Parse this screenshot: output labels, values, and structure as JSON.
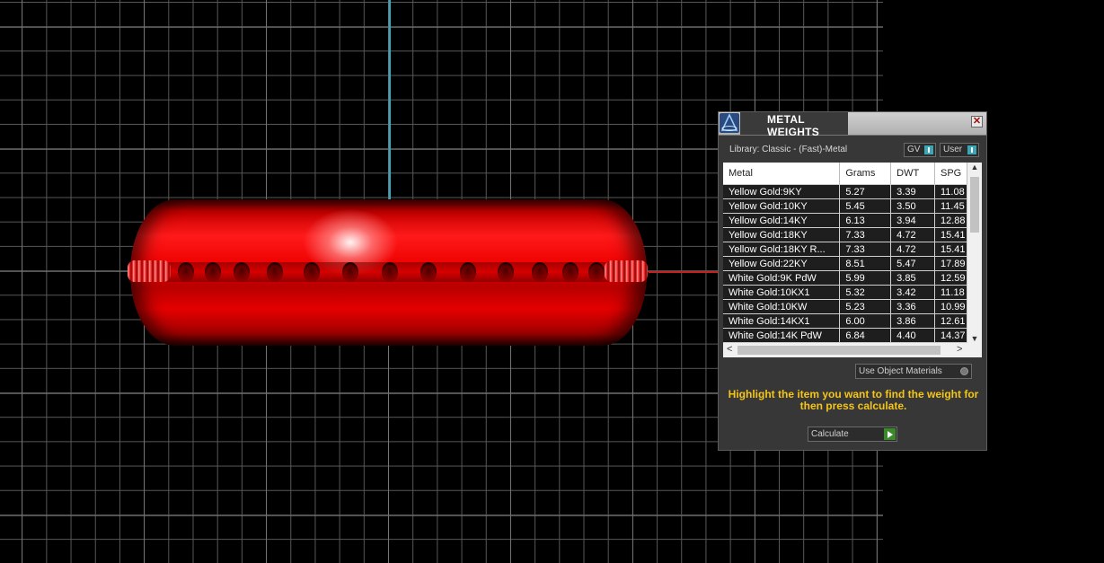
{
  "panel": {
    "title": "METAL WEIGHTS",
    "close_label": "✕",
    "library_label": "Library: Classic - (Fast)-Metal",
    "toggle_gv": "GV",
    "toggle_user": "User",
    "table": {
      "headers": [
        "Metal",
        "Grams",
        "DWT",
        "SPG"
      ],
      "rows": [
        [
          "Yellow Gold:9KY",
          "5.27",
          "3.39",
          "11.08"
        ],
        [
          "Yellow Gold:10KY",
          "5.45",
          "3.50",
          "11.45"
        ],
        [
          "Yellow Gold:14KY",
          "6.13",
          "3.94",
          "12.88"
        ],
        [
          "Yellow Gold:18KY",
          "7.33",
          "4.72",
          "15.41"
        ],
        [
          "Yellow Gold:18KY R...",
          "7.33",
          "4.72",
          "15.41"
        ],
        [
          "Yellow Gold:22KY",
          "8.51",
          "5.47",
          "17.89"
        ],
        [
          "White Gold:9K PdW",
          "5.99",
          "3.85",
          "12.59"
        ],
        [
          "White Gold:10KX1",
          "5.32",
          "3.42",
          "11.18"
        ],
        [
          "White Gold:10KW",
          "5.23",
          "3.36",
          "10.99"
        ],
        [
          "White Gold:14KX1",
          "6.00",
          "3.86",
          "12.61"
        ],
        [
          "White Gold:14K PdW",
          "6.84",
          "4.40",
          "14.37"
        ]
      ]
    },
    "use_object_materials": "Use Object Materials",
    "instruction": "Highlight the item you want to find the weight for then press calculate.",
    "calculate_label": "Calculate"
  },
  "icons": {
    "logo": "app-logo-icon",
    "close": "close-icon",
    "scroll_up": "scroll-up-icon",
    "scroll_down": "scroll-down-icon",
    "scroll_left": "scroll-left-icon",
    "scroll_right": "scroll-right-icon",
    "go": "play-arrow-icon"
  },
  "colors": {
    "instruction_text": "#f5c518",
    "ring": "#e00000",
    "axis_vertical": "#2aa9c9",
    "axis_horizontal": "#c52020",
    "toggle_knob": "#3ba6b5",
    "calculate_go": "#3a8a2a"
  }
}
